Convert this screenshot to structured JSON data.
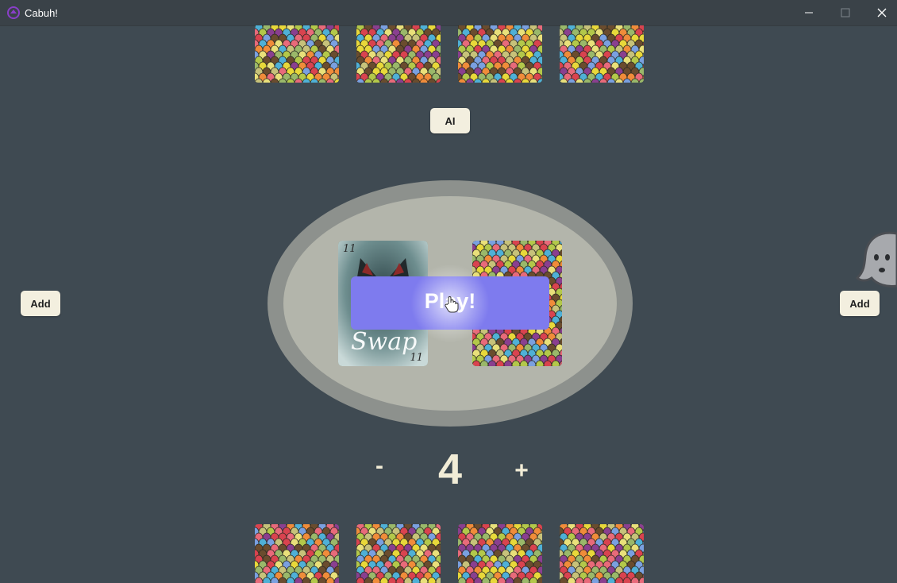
{
  "window": {
    "title": "Cabuh!",
    "minimize_icon": "minimize-icon",
    "maximize_icon": "maximize-icon",
    "close_icon": "close-icon"
  },
  "colors": {
    "background": "#3f4a52",
    "table_outer": "#8d918d",
    "table_inner": "#b3b5ab",
    "play_button": "#7e7bee",
    "button_bg": "#f3efdf",
    "text_light": "#f1ecd6"
  },
  "controls": {
    "ai_label": "AI",
    "add_left_label": "Add",
    "add_right_label": "Add",
    "play_label": "Play!",
    "minus_label": "-",
    "plus_label": "+",
    "player_count": "4"
  },
  "center": {
    "discard_card": {
      "name": "Swap",
      "rank": "11"
    },
    "deck": "face-down"
  },
  "hands": {
    "top_count": 4,
    "bottom_count": 4
  },
  "opponent_avatar": "ghost-icon"
}
